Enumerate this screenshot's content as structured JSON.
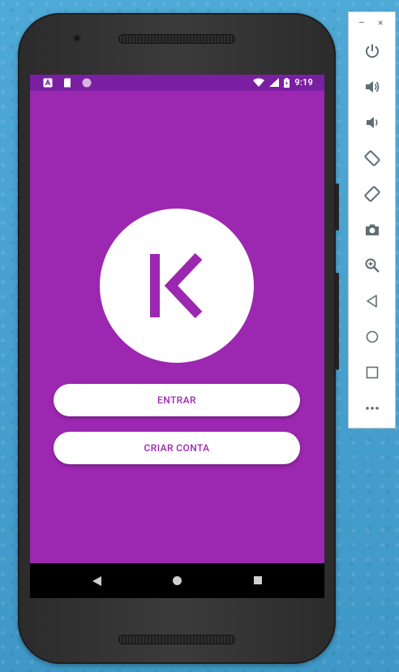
{
  "status_bar": {
    "time": "9:19"
  },
  "buttons": {
    "entrar": "ENTRAR",
    "criar_conta": "CRIAR CONTA"
  },
  "logo": {
    "letter": "K"
  },
  "toolbar": {
    "title_controls": {
      "minimize": "–",
      "close": "×"
    },
    "items": [
      "power-icon",
      "volume-up-icon",
      "volume-down-icon",
      "rotate-left-icon",
      "rotate-right-icon",
      "camera-icon",
      "zoom-icon",
      "back-icon",
      "home-icon",
      "overview-icon",
      "more-icon"
    ]
  },
  "colors": {
    "primary": "#9c27b0",
    "primary_dark": "#7b1fa2",
    "background": "#4aa3cf",
    "toolbar_icon": "#5f6e76"
  }
}
